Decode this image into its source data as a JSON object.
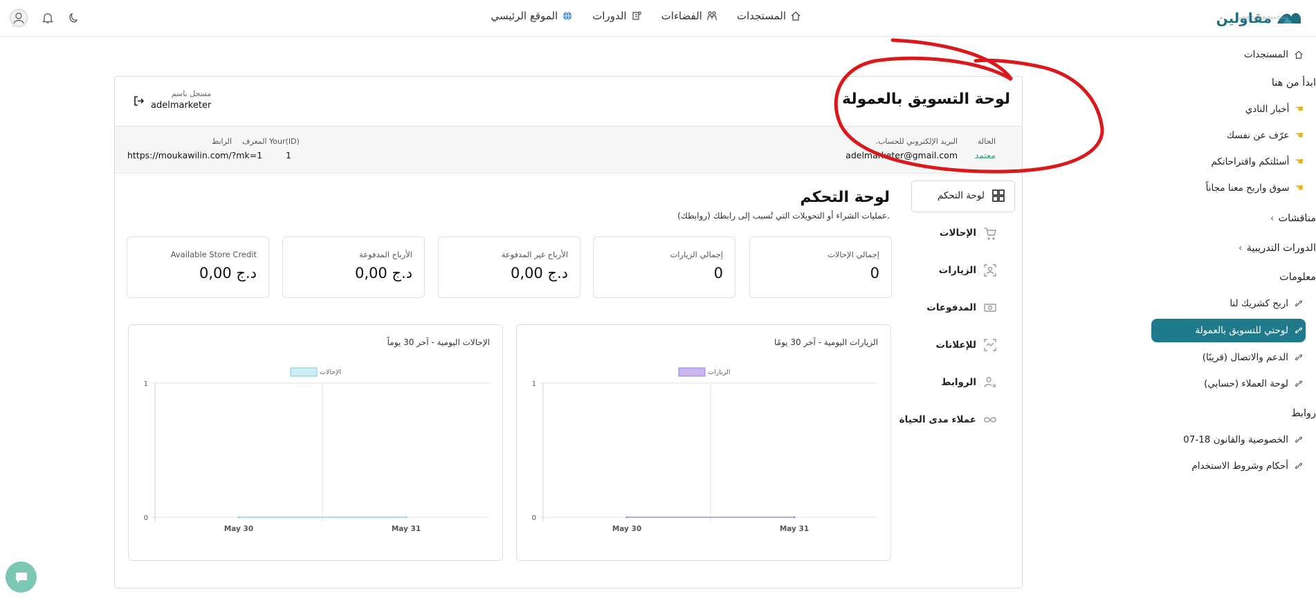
{
  "topbar": {
    "logo": "مقاولين",
    "logo_tagline": "Jadidi Says Before Dong",
    "nav": [
      {
        "label": "المستجدات",
        "icon": "home-icon"
      },
      {
        "label": "الفضاءات",
        "icon": "spaces-icon"
      },
      {
        "label": "الدورات",
        "icon": "courses-icon"
      },
      {
        "label": "الموقع الرئيسي",
        "icon": "globe-icon"
      }
    ]
  },
  "sidebar": {
    "news": "المستجدات",
    "start_here": "ابدأ من هنا",
    "start_items": [
      "أخبار النادي",
      "عرّف عن نفسك",
      "أسئلتكم واقتراحاتكم",
      "سوق واربح معنا مجاناً"
    ],
    "discussions": "مناقشات",
    "training": "الدورات التدريبية",
    "info": "معلومات",
    "info_items": [
      "اربح كشريك لنا",
      "لوحتي للتسويق بالعمولة",
      "الدعم والاتصال (قريبًا)",
      "لوحة العملاء (حسابي)"
    ],
    "links": "روابط",
    "links_items": [
      "الخصوصية والقانون 18-07",
      "أحكام وشروط الاستخدام"
    ]
  },
  "card": {
    "title": "لوحة التسويق بالعمولة",
    "logged_label": "مسجل باسم",
    "logged_user": "adelmarketer",
    "status_label": "الحالة",
    "status_value": "معتمد",
    "email_label": ".البريد الإلكتروني للحساب",
    "email_value": "adelmarketer@gmail.com",
    "id_label": "المعرف Your(ID)",
    "id_value": "1",
    "link_label": "الرابط",
    "link_value": "https://moukawilin.com/?mk=1"
  },
  "menu": [
    {
      "label": "لوحة التحكم",
      "icon": "dashboard-icon"
    },
    {
      "label": "الإحالات",
      "icon": "cart-icon"
    },
    {
      "label": "الزيارات",
      "icon": "scan-user-icon"
    },
    {
      "label": "المدفوعات",
      "icon": "cash-icon"
    },
    {
      "label": "للإعلانات",
      "icon": "ads-icon"
    },
    {
      "label": "الروابط",
      "icon": "user-link-icon"
    },
    {
      "label": "عملاء مدى الحياة",
      "icon": "infinity-icon"
    }
  ],
  "dashboard": {
    "title": "لوحة التحكم",
    "subtitle": "عمليات الشراء أو التحويلات التي تُسبب إلى رابطك (روابطك).",
    "stats": [
      {
        "label": "إجمالي الإحالات",
        "value": "0"
      },
      {
        "label": "إجمالي الزيارات",
        "value": "0"
      },
      {
        "label": "الأرباح غير المدفوعة",
        "value": "د.ج 0,00"
      },
      {
        "label": "الأرباح المدفوعة",
        "value": "د.ج 0,00"
      },
      {
        "label": "Available Store Credit",
        "value": "د.ج 0,00"
      }
    ]
  },
  "colors": {
    "accent": "#1f7a8c",
    "status_green": "#2e9e6b",
    "annotation_red": "#d9191c",
    "visits_series": "#c9b6ef",
    "referrals_series": "#cdeef2"
  },
  "chart_data": [
    {
      "type": "line",
      "title": "الزيارات اليومية - آخر 30 يومًا",
      "categories": [
        "May 30",
        "May 31"
      ],
      "series": [
        {
          "name": "الزيارات",
          "values": [
            0,
            0
          ]
        }
      ],
      "ylim": [
        0,
        1
      ],
      "yticks": [
        "1",
        "0"
      ],
      "legend": "top"
    },
    {
      "type": "line",
      "title": "الإحالات اليومية - آخر 30 يوماً",
      "categories": [
        "May 30",
        "May 31"
      ],
      "series": [
        {
          "name": "الإحالات",
          "values": [
            0,
            0
          ]
        }
      ],
      "ylim": [
        0,
        1
      ],
      "yticks": [
        "1",
        "0"
      ],
      "legend": "top"
    }
  ]
}
